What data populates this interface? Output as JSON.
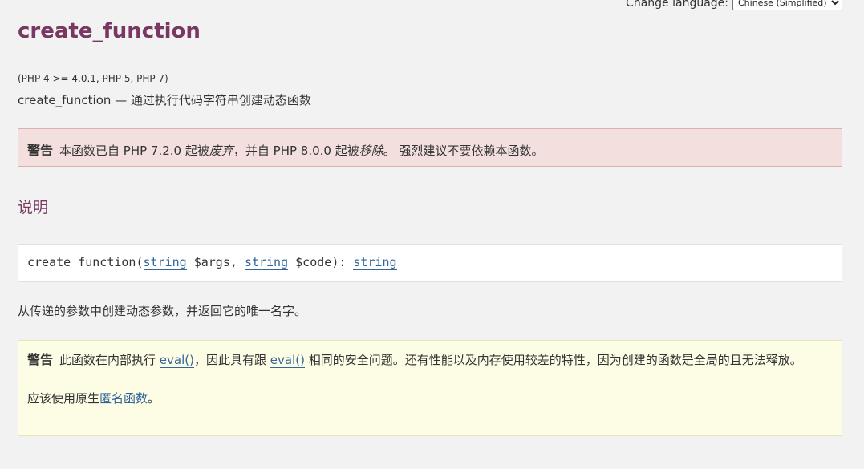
{
  "language_bar": {
    "label": "Change language:",
    "selected": "Chinese (Simplified)"
  },
  "title": "create_function",
  "version": "(PHP 4 >= 4.0.1, PHP 5, PHP 7)",
  "purpose": "create_function — 通过执行代码字符串创建动态函数",
  "deprecation_warning": {
    "label": "警告",
    "text_1": "本函数已自 PHP 7.2.0 起被",
    "em_1": "废弃",
    "text_2": "，并自 PHP 8.0.0 起被",
    "em_2": "移除",
    "text_3": "。 强烈建议不要依赖本函数。"
  },
  "description_section": {
    "title": "说明"
  },
  "signature": {
    "function": "create_function",
    "open": "(",
    "param1_type": "string",
    "param1_name": " $args",
    "sep": ", ",
    "param2_type": "string",
    "param2_name": " $code",
    "close": "): ",
    "return_type": "string"
  },
  "description": "从传递的参数中创建动态参数，并返回它的唯一名字。",
  "security_warning": {
    "label": "警告",
    "text_1": "此函数在内部执行 ",
    "link_1": "eval()",
    "text_2": "，因此具有跟 ",
    "link_2": "eval()",
    "text_3": " 相同的安全问题。还有性能以及内存使用较差的特性，因为创建的函数是全局的且无法释放。",
    "advice_prefix": "应该使用原生",
    "advice_link": "匿名函数",
    "advice_suffix": "。"
  }
}
